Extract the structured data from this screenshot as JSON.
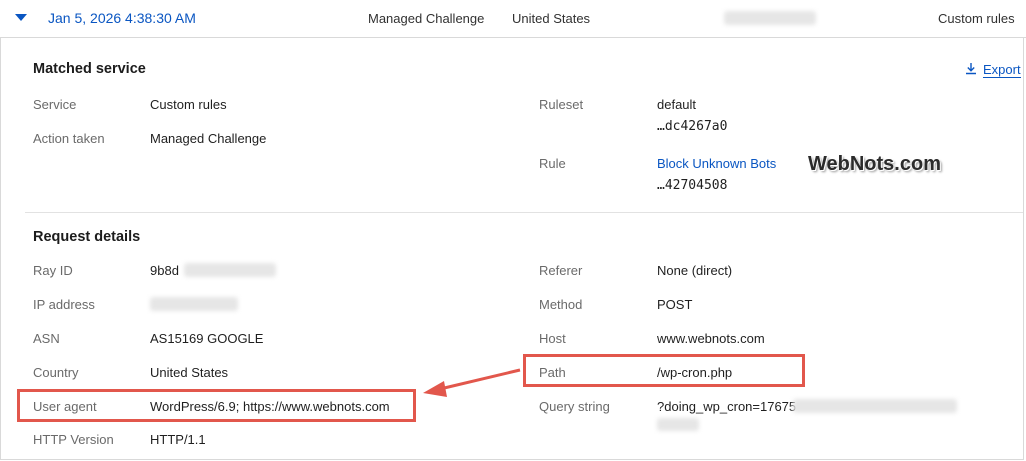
{
  "header": {
    "timestamp": "Jan 5, 2026 4:38:30 AM",
    "action": "Managed Challenge",
    "country": "United States",
    "service": "Custom rules"
  },
  "export_label": "Export",
  "matched_service": {
    "title": "Matched service",
    "service_label": "Service",
    "service_value": "Custom rules",
    "action_label": "Action taken",
    "action_value": "Managed Challenge",
    "ruleset_label": "Ruleset",
    "ruleset_value": "default",
    "ruleset_id": "…dc4267a0",
    "rule_label": "Rule",
    "rule_value": "Block Unknown Bots",
    "rule_id": "…42704508"
  },
  "watermark": "WebNots.com",
  "request_details": {
    "title": "Request details",
    "ray_id_label": "Ray ID",
    "ray_id_value": "9b8d",
    "ip_label": "IP address",
    "asn_label": "ASN",
    "asn_value": "AS15169 GOOGLE",
    "country_label": "Country",
    "country_value": "United States",
    "ua_label": "User agent",
    "ua_value": "WordPress/6.9; https://www.webnots.com",
    "http_label": "HTTP Version",
    "http_value": "HTTP/1.1",
    "referer_label": "Referer",
    "referer_value": "None (direct)",
    "method_label": "Method",
    "method_value": "POST",
    "host_label": "Host",
    "host_value": "www.webnots.com",
    "path_label": "Path",
    "path_value": "/wp-cron.php",
    "query_label": "Query string",
    "query_value": "?doing_wp_cron=17675"
  },
  "colors": {
    "accent": "#0a56c2",
    "highlight": "#e2574c"
  }
}
